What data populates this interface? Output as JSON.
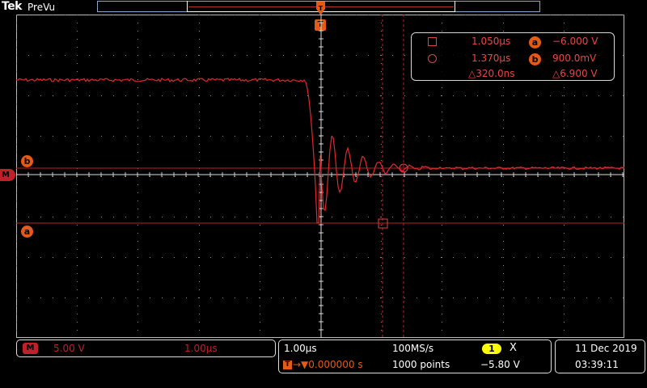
{
  "header": {
    "brand_text": "Tek",
    "acq_status": "PreVu"
  },
  "markers": {
    "trigger_label": "T",
    "math_label": "M",
    "cursor_b_label": "b",
    "cursor_a_label": "a"
  },
  "cursor_readout": {
    "time1": "1.050µs",
    "time2": "1.370µs",
    "delta_time": "△320.0ns",
    "volt_a": "−6.000 V",
    "volt_b": "900.0mV",
    "delta_volt": "△6.900 V",
    "badge_a": "a",
    "badge_b": "b"
  },
  "math_channel": {
    "label": "M",
    "volts_div": "5.00 V",
    "time_div": "1.00µs"
  },
  "horizontal": {
    "time_div": "1.00µs",
    "sample_rate": "100MS/s",
    "trigger_pos_icon_label": "T",
    "trigger_pos": "→▼0.000000 s",
    "record_length": "1000 points"
  },
  "trigger": {
    "channel": "1",
    "slope_icon": "X",
    "level": "−5.80 V"
  },
  "datetime": {
    "date": "11 Dec  2019",
    "time": "03:39:11"
  },
  "colors": {
    "waveform": "#e0282d",
    "accent": "#e55a14",
    "channel1": "#ffff00",
    "math": "#c0202a"
  },
  "icons": {
    "trigger_marker": "trigger-arrow-icon",
    "cursor1": "square-cursor-icon",
    "cursor2": "circle-cursor-icon"
  }
}
